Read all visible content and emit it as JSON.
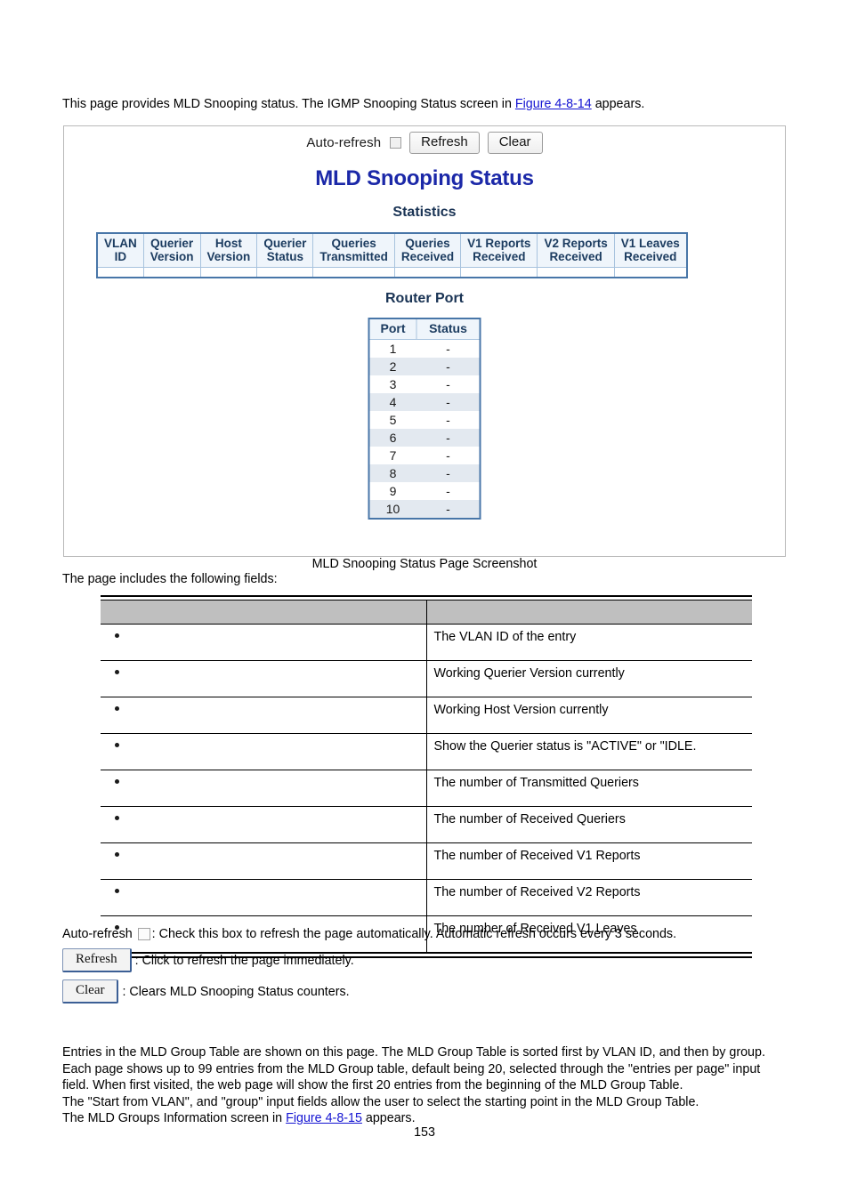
{
  "intro": {
    "before_link": "This page provides MLD Snooping status. The IGMP Snooping Status screen in ",
    "link_text": "Figure 4-8-14",
    "after_link": " appears."
  },
  "screenshot": {
    "toolbar": {
      "auto_refresh_label": "Auto-refresh",
      "auto_refresh_checked": false,
      "refresh_label": "Refresh",
      "clear_label": "Clear"
    },
    "title": "MLD Snooping Status",
    "statistics": {
      "subtitle": "Statistics",
      "headers": [
        "VLAN\nID",
        "Querier\nVersion",
        "Host\nVersion",
        "Querier\nStatus",
        "Queries\nTransmitted",
        "Queries\nReceived",
        "V1 Reports\nReceived",
        "V2 Reports\nReceived",
        "V1 Leaves\nReceived"
      ],
      "rows": []
    },
    "router_port": {
      "subtitle": "Router Port",
      "headers": [
        "Port",
        "Status"
      ],
      "rows": [
        {
          "port": "1",
          "status": "-"
        },
        {
          "port": "2",
          "status": "-"
        },
        {
          "port": "3",
          "status": "-"
        },
        {
          "port": "4",
          "status": "-"
        },
        {
          "port": "5",
          "status": "-"
        },
        {
          "port": "6",
          "status": "-"
        },
        {
          "port": "7",
          "status": "-"
        },
        {
          "port": "8",
          "status": "-"
        },
        {
          "port": "9",
          "status": "-"
        },
        {
          "port": "10",
          "status": "-"
        }
      ]
    },
    "colors": {
      "title": "#1b28a8",
      "subtitle": "#193354",
      "table_border": "#4876a8",
      "header_bg": "#eff5fb",
      "stripe_bg": "#e3e9f0"
    }
  },
  "caption": "MLD Snooping Status Page Screenshot",
  "lead_in": "The page includes the following fields:",
  "fields_table": {
    "header": {
      "object": "",
      "description": ""
    },
    "rows": [
      {
        "object": "",
        "description": "The VLAN ID of the entry"
      },
      {
        "object": "",
        "description": "Working Querier Version currently"
      },
      {
        "object": "",
        "description": "Working Host Version currently"
      },
      {
        "object": "",
        "description": "Show the Querier status is \"ACTIVE\" or \"IDLE."
      },
      {
        "object": "",
        "description": "The number of Transmitted Queriers"
      },
      {
        "object": "",
        "description": "The number of Received Queriers"
      },
      {
        "object": "",
        "description": "The number of Received V1 Reports"
      },
      {
        "object": "",
        "description": "The number of Received V2 Reports"
      },
      {
        "object": "",
        "description": "The number of Received V1 Leaves"
      }
    ]
  },
  "legend": {
    "auto_refresh_label": "Auto-refresh",
    "auto_refresh_desc": ": Check this box to refresh the page automatically. Automatic refresh occurs every 3 seconds.",
    "refresh_button": "Refresh",
    "refresh_desc": ": Click to refresh the page immediately.",
    "clear_button": "Clear",
    "clear_desc": ": Clears MLD Snooping Status counters."
  },
  "closing": {
    "line1": "Entries in the MLD Group Table are shown on this page. The MLD Group Table is sorted first by VLAN ID, and then by group.",
    "line2": "Each page shows up to 99 entries from the MLD Group table, default being 20, selected through the \"entries per page\" input",
    "line3": "field. When first visited, the web page will show the first 20 entries from the beginning of the MLD Group Table.",
    "line4": "The \"Start from VLAN\", and \"group\" input fields allow the user to select the starting point in the MLD Group Table.",
    "line5_before": "The MLD Groups Information screen in ",
    "line5_link": "Figure 4-8-15",
    "line5_after": " appears."
  },
  "page_number": "153"
}
